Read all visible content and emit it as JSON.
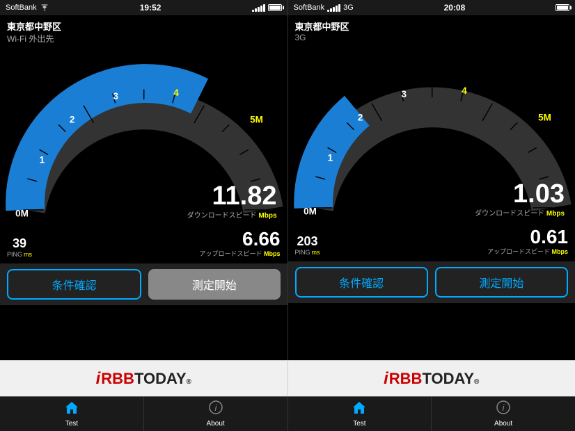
{
  "screens": [
    {
      "id": "wifi",
      "statusBar": {
        "carrier": "SoftBank",
        "time": "19:52",
        "network": "Wi-Fi",
        "batteryFull": true
      },
      "location": "東京都中野区",
      "connectionType": "Wi-Fi 外出先",
      "downloadSpeed": "11.82",
      "downloadLabel": "ダウンロードスピード",
      "downloadUnit": "Mbps",
      "ping": "39",
      "pingLabel": "PING",
      "pingUnit": "ms",
      "uploadSpeed": "6.66",
      "uploadLabel": "アップロードスピード",
      "uploadUnit": "Mbps",
      "btnCheck": "条件確認",
      "btnStart": "測定開始",
      "btnStartActive": false
    },
    {
      "id": "3g",
      "statusBar": {
        "carrier": "SoftBank",
        "time": "20:08",
        "network": "3G",
        "batteryFull": true
      },
      "location": "東京都中野区",
      "connectionType": "3G",
      "downloadSpeed": "1.03",
      "downloadLabel": "ダウンロードスピード",
      "downloadUnit": "Mbps",
      "ping": "203",
      "pingLabel": "PING",
      "pingUnit": "ms",
      "uploadSpeed": "0.61",
      "uploadLabel": "アップロードスピード",
      "uploadUnit": "Mbps",
      "btnCheck": "条件確認",
      "btnStart": "測定開始",
      "btnStartActive": true
    }
  ],
  "logoText": "iRBBTODAY.",
  "tabs": [
    {
      "id": "test1",
      "icon": "house",
      "label": "Test",
      "active": true
    },
    {
      "id": "about1",
      "icon": "info",
      "label": "About",
      "active": false
    },
    {
      "id": "test2",
      "icon": "house",
      "label": "Test",
      "active": true
    },
    {
      "id": "about2",
      "icon": "info",
      "label": "About",
      "active": false
    }
  ]
}
